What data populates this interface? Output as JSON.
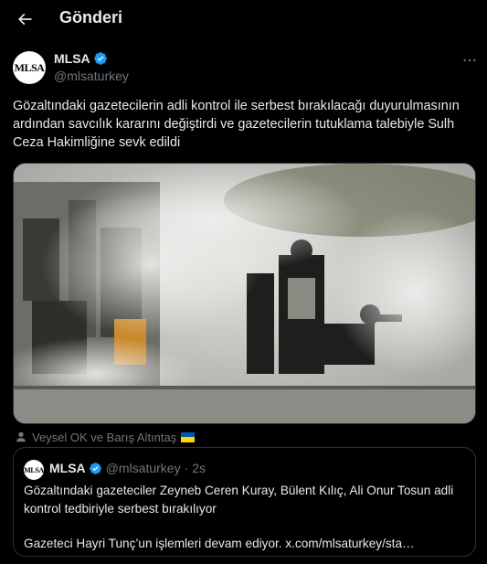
{
  "header": {
    "title": "Gönderi"
  },
  "author": {
    "name": "MLSA",
    "handle": "@mlsaturkey",
    "avatar_text": "MLSA"
  },
  "tweet": {
    "text": "Gözaltındaki gazetecilerin adli kontrol ile serbest bırakılacağı duyurulmasının ardından savcılık kararını değiştirdi ve gazetecilerin tutuklama talebiyle Sulh Ceza Hakimliğine sevk edildi"
  },
  "tagged": {
    "text": "Veysel OK ve Barış Altıntaş"
  },
  "quote": {
    "name": "MLSA",
    "handle": "@mlsaturkey",
    "separator": "·",
    "time": "2s",
    "avatar_text": "MLSA",
    "line1": "Gözaltındaki gazeteciler Zeyneb Ceren Kuray, Bülent Kılıç, Ali Onur Tosun adli kontrol tedbiriyle serbest bırakılıyor",
    "line2": "Gazeteci Hayri Tunç’un işlemleri devam ediyor. x.com/mlsaturkey/sta…"
  },
  "icons": {
    "back": "arrow-left-icon",
    "verified": "verified-badge-icon",
    "more": "more-horizontal-icon",
    "person": "person-icon",
    "flag": "ukraine-flag-icon"
  },
  "colors": {
    "background": "#000000",
    "text": "#e7e9ea",
    "secondary": "#71767b",
    "border": "#2f3336",
    "verified": "#1d9bf0"
  }
}
